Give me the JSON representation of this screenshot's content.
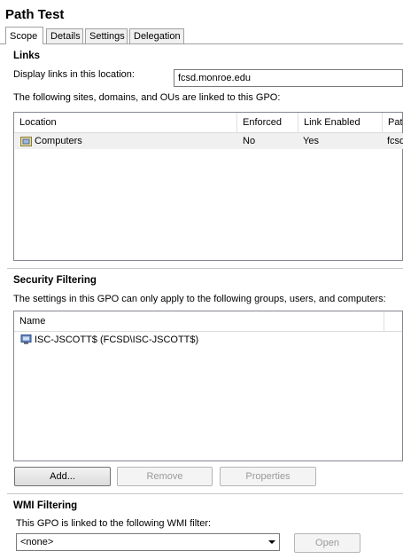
{
  "title": "Path Test",
  "tabs": [
    {
      "label": "Scope",
      "active": true
    },
    {
      "label": "Details",
      "active": false
    },
    {
      "label": "Settings",
      "active": false
    },
    {
      "label": "Delegation",
      "active": false
    }
  ],
  "links": {
    "heading": "Links",
    "location_label": "Display links in this location:",
    "location_value": "fcsd.monroe.edu",
    "description": "The following sites, domains, and OUs are linked to this GPO:",
    "columns": [
      "Location",
      "Enforced",
      "Link Enabled",
      "Path"
    ],
    "rows": [
      {
        "location": "Computers",
        "enforced": "No",
        "link_enabled": "Yes",
        "path": "fcsd"
      }
    ]
  },
  "security": {
    "heading": "Security Filtering",
    "description": "The settings in this GPO can only apply to the following groups, users, and computers:",
    "columns": [
      "Name"
    ],
    "rows": [
      {
        "name": "ISC-JSCOTT$ (FCSD\\ISC-JSCOTT$)"
      }
    ],
    "buttons": {
      "add": "Add...",
      "remove": "Remove",
      "properties": "Properties"
    }
  },
  "wmi": {
    "heading": "WMI Filtering",
    "description": "This GPO is linked to the following WMI filter:",
    "filter_value": "<none>",
    "open_label": "Open"
  }
}
